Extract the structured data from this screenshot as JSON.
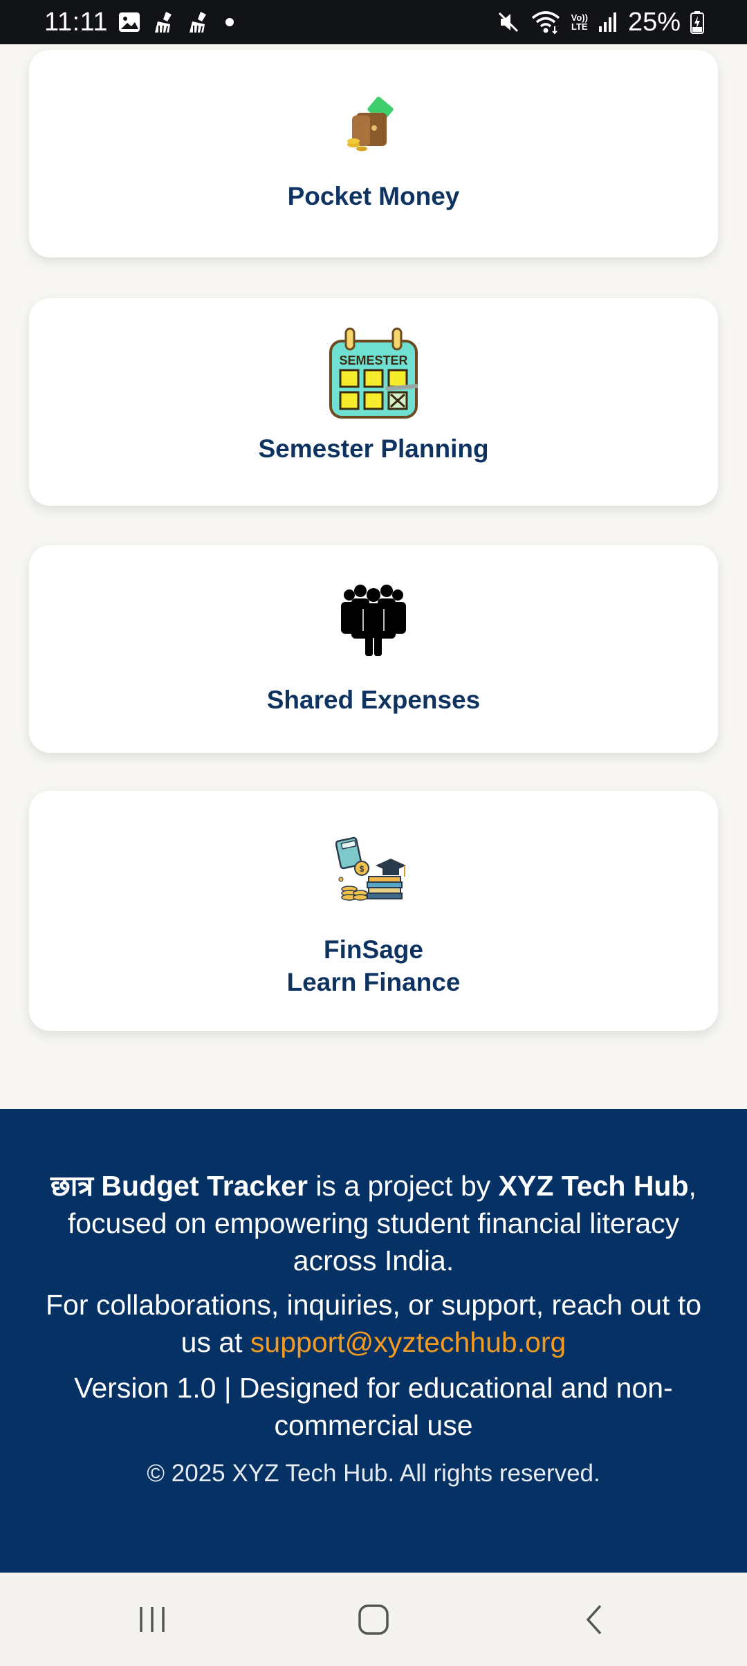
{
  "status_bar": {
    "time": "11:11",
    "battery": "25%",
    "lte_top": "Vo))",
    "lte_bottom": "LTE"
  },
  "cards": [
    {
      "label_lines": [
        "Pocket Money"
      ],
      "icon": "wallet-icon"
    },
    {
      "label_lines": [
        "Semester Planning"
      ],
      "icon": "semester-calendar-icon",
      "icon_text": "SEMESTER"
    },
    {
      "label_lines": [
        "Shared Expenses"
      ],
      "icon": "group-people-icon"
    },
    {
      "label_lines": [
        "FinSage",
        "Learn Finance"
      ],
      "icon": "finance-education-icon"
    }
  ],
  "footer": {
    "brand_name": "छात्र Budget Tracker",
    "project_text": " is a project by ",
    "org_name": "XYZ Tech Hub",
    "mission_text": ", focused on empowering student financial literacy across India.",
    "contact_text": "For collaborations, inquiries, or support, reach out to us at ",
    "email": "support@xyztechhub.org",
    "version_text": "Version 1.0 | Designed for educational and non-commercial use",
    "copyright": "© 2025 XYZ Tech Hub. All rights reserved."
  },
  "colors": {
    "card_label": "#0e3361",
    "footer_bg": "#063164",
    "link": "#f39a21"
  }
}
